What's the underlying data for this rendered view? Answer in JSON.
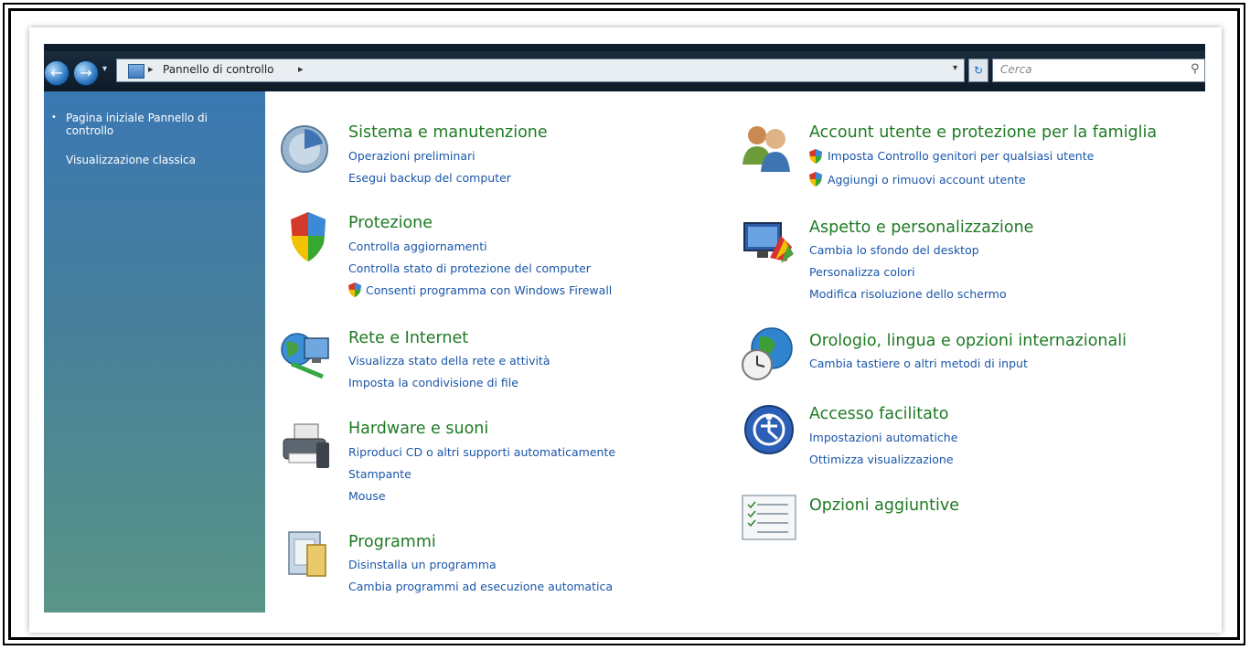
{
  "window": {
    "breadcrumb": "Pannello di controllo",
    "search_placeholder": "Cerca"
  },
  "sidebar": {
    "home_link": "Pagina iniziale Pannello di controllo",
    "classic_link": "Visualizzazione classica"
  },
  "categories": [
    {
      "title": "Sistema e manutenzione",
      "icon": "system-maintenance-icon",
      "tasks": [
        "Operazioni preliminari",
        "Esegui backup del computer"
      ]
    },
    {
      "title": "Protezione",
      "icon": "security-shield-icon",
      "tasks": [
        "Controlla aggiornamenti",
        "Controlla stato di protezione del computer",
        "Consenti programma con Windows Firewall"
      ]
    },
    {
      "title": "Rete e Internet",
      "icon": "network-internet-icon",
      "tasks": [
        "Visualizza stato della rete e attività",
        "Imposta la condivisione di file"
      ]
    },
    {
      "title": "Hardware e suoni",
      "icon": "hardware-sound-icon",
      "tasks": [
        "Riproduci CD o altri supporti automaticamente",
        "Stampante",
        "Mouse"
      ]
    },
    {
      "title": "Programmi",
      "icon": "programs-icon",
      "tasks": [
        "Disinstalla un programma",
        "Cambia programmi ad esecuzione automatica"
      ]
    },
    {
      "title": "Account utente e protezione per la famiglia",
      "icon": "user-accounts-icon",
      "tasks": [
        "Imposta Controllo genitori per qualsiasi utente",
        "Aggiungi o rimuovi account utente"
      ]
    },
    {
      "title": "Aspetto e personalizzazione",
      "icon": "appearance-icon",
      "tasks": [
        "Cambia lo sfondo del desktop",
        "Personalizza colori",
        "Modifica risoluzione dello schermo"
      ]
    },
    {
      "title": "Orologio, lingua e opzioni internazionali",
      "icon": "clock-globe-icon",
      "tasks": [
        "Cambia tastiere o altri metodi di input"
      ]
    },
    {
      "title": "Accesso facilitato",
      "icon": "ease-of-access-icon",
      "tasks": [
        "Impostazioni automatiche",
        "Ottimizza visualizzazione"
      ]
    },
    {
      "title": "Opzioni aggiuntive",
      "icon": "additional-options-icon",
      "tasks": []
    }
  ]
}
